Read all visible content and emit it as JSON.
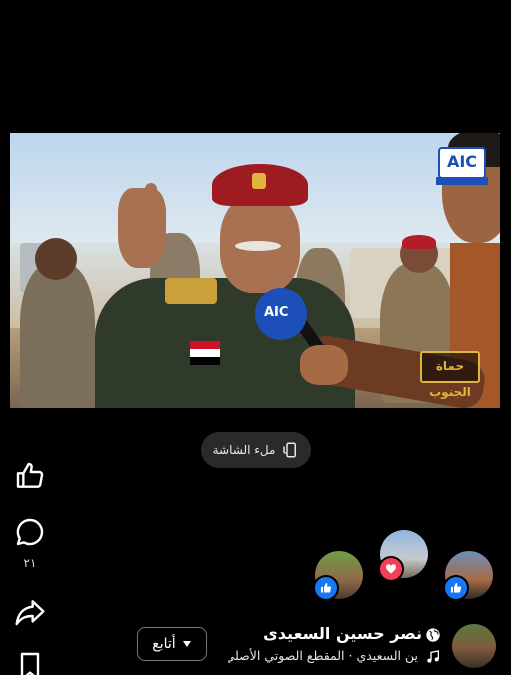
{
  "video": {
    "logo_text": "AIC",
    "watermark_text": "حماة الجنوب"
  },
  "fullscreen_button": {
    "label": "ملء الشاشة",
    "icon": "fullscreen-rotate-icon"
  },
  "actions": {
    "like_icon": "thumbs-up-icon",
    "comment_icon": "comment-bubble-icon",
    "comment_count": "٢١",
    "share_icon": "share-arrow-icon",
    "save_icon": "bookmark-icon"
  },
  "reactions": [
    {
      "badge": "like",
      "color": "#1877f2"
    },
    {
      "badge": "love",
      "color": "#f33e58"
    },
    {
      "badge": "like",
      "color": "#1877f2"
    }
  ],
  "author": {
    "name": "نصر حسين السعيدى",
    "audio_text": "ين السعيدي · المقطع الصوتي الأصلي",
    "follow_label": "أتابع"
  },
  "colors": {
    "background": "#000000",
    "accent_blue": "#1877f2",
    "love_red": "#f33e58"
  }
}
